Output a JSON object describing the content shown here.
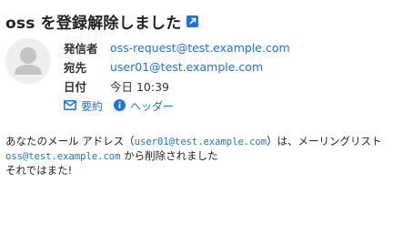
{
  "header": {
    "title": "oss を登録解除しました",
    "external_link_icon": "external-link-icon"
  },
  "avatar": {
    "icon": "user-avatar-icon"
  },
  "meta": {
    "sender_label": "発信者",
    "sender_value": "oss-request@test.example.com",
    "to_label": "宛先",
    "to_value": "user01@test.example.com",
    "date_label": "日付",
    "date_value": "今日 10:39"
  },
  "actions": {
    "summary_label": "要約",
    "summary_icon": "envelope-icon",
    "header_label": "ヘッダー",
    "header_icon": "info-icon"
  },
  "body": {
    "line1_prefix": "あなたのメール アドレス（",
    "line1_address": "user01@test.example.com",
    "line1_suffix": "）は、メーリングリスト",
    "line2_list": "oss@test.example.com",
    "line2_suffix": " から削除されました",
    "line3": "それではまた!"
  },
  "colors": {
    "accent": "#1a73e8",
    "text": "#222222",
    "avatar_bg": "#eeeeee"
  }
}
